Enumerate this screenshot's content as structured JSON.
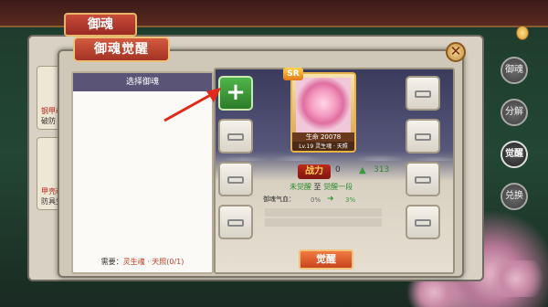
{
  "back": {
    "title": "御魂",
    "list": [
      {
        "name": "钢甲魂",
        "sub": "破防"
      },
      {
        "name": "甲壳魂",
        "sub": "防具生命"
      }
    ]
  },
  "modal": {
    "title": "御魂觉醒",
    "close": "✕",
    "left": {
      "header": "选择御魂",
      "need_label": "需要：",
      "need_value": "灵生魂 · 天照(0/1)"
    },
    "card": {
      "rarity": "SR",
      "line1": "生命 20078",
      "line2": "Lv.19 灵生魂 · 天照"
    },
    "power": {
      "label": "战力",
      "from": "0",
      "arrow": "▲",
      "to": "313"
    },
    "stage": {
      "from": "未觉醒",
      "sep": "至",
      "to": "觉醒一段"
    },
    "attr": {
      "label": "御魂气血：",
      "from": "0%",
      "arrow": "➜",
      "to": "3%"
    },
    "awaken_button": "觉醒",
    "plus_slot": "+"
  },
  "side_tabs": [
    {
      "label": "御魂",
      "active": false
    },
    {
      "label": "分解",
      "active": false
    },
    {
      "label": "觉醒",
      "active": true
    },
    {
      "label": "兑换",
      "active": false
    }
  ],
  "colors": {
    "accent": "#c94c3a",
    "green": "#2d8a2d",
    "header": "#5a5577"
  }
}
